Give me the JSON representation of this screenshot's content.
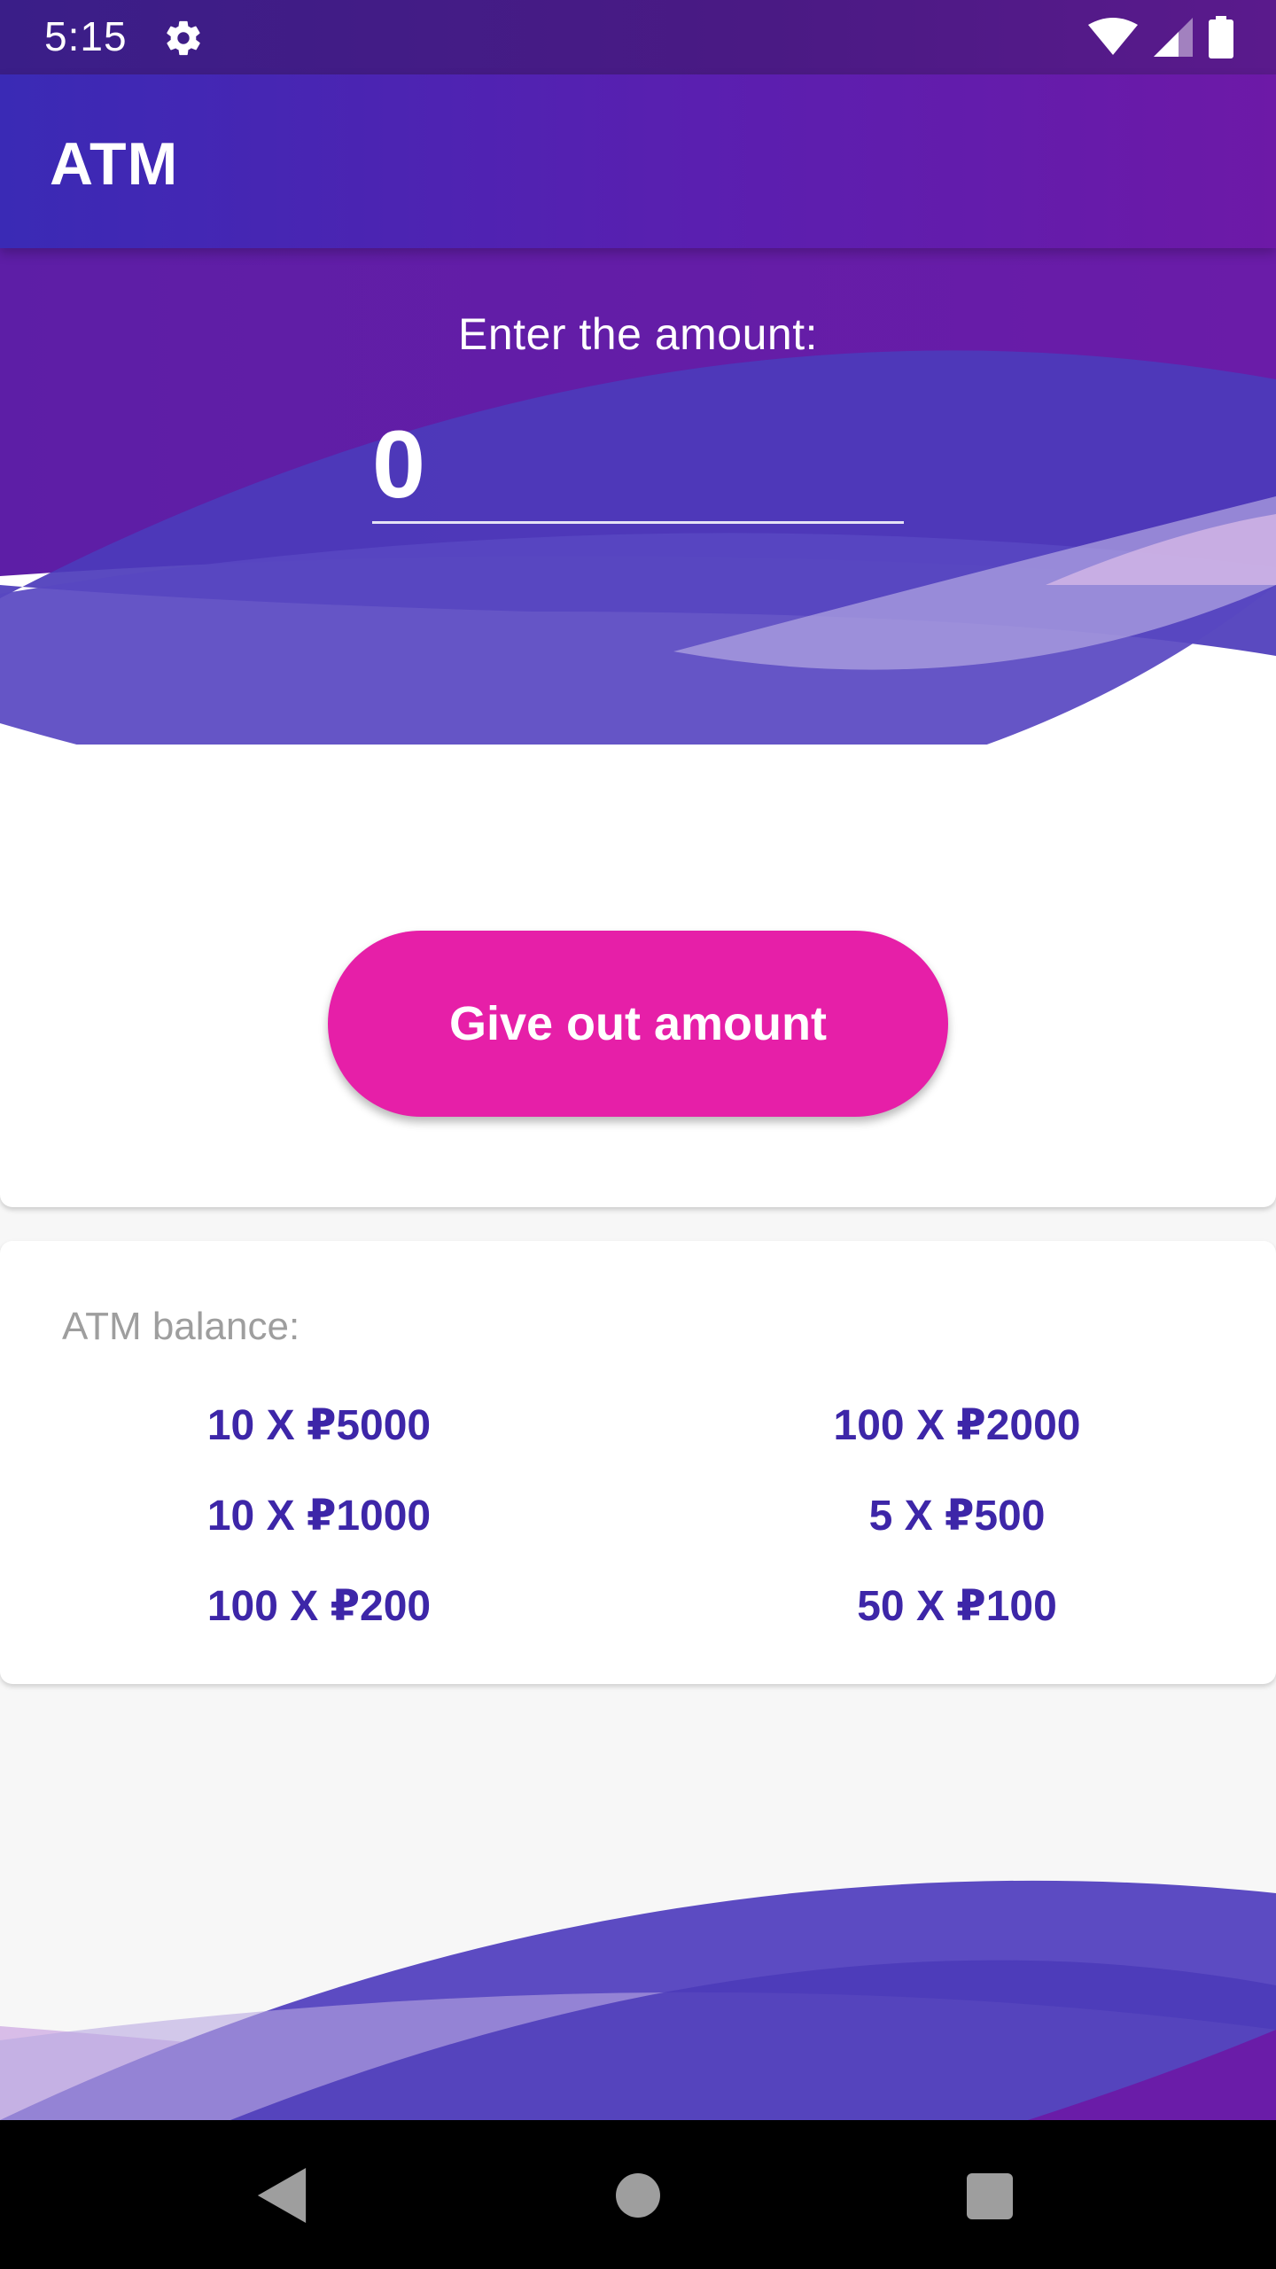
{
  "status_bar": {
    "time": "5:15",
    "icons": [
      "gear-icon",
      "wifi-icon",
      "signal-icon",
      "battery-icon"
    ]
  },
  "app_bar": {
    "title": "ATM"
  },
  "amount_form": {
    "label": "Enter the amount:",
    "value": "0",
    "button_label": "Give out amount"
  },
  "balance": {
    "title": "ATM balance:",
    "items": [
      "10 X ₽5000",
      "100 X ₽2000",
      "10 X ₽1000",
      "5 X ₽500",
      "100 X ₽200",
      "50 X ₽100"
    ]
  },
  "nav_bar": {
    "icons": [
      "back-icon",
      "home-icon",
      "recents-icon"
    ]
  },
  "colors": {
    "primary": "#3d26a8",
    "accent": "#e61fa8",
    "app_bar_start": "#3a2ab5",
    "app_bar_end": "#6d19a7",
    "balance_title": "#9e9e9e"
  }
}
